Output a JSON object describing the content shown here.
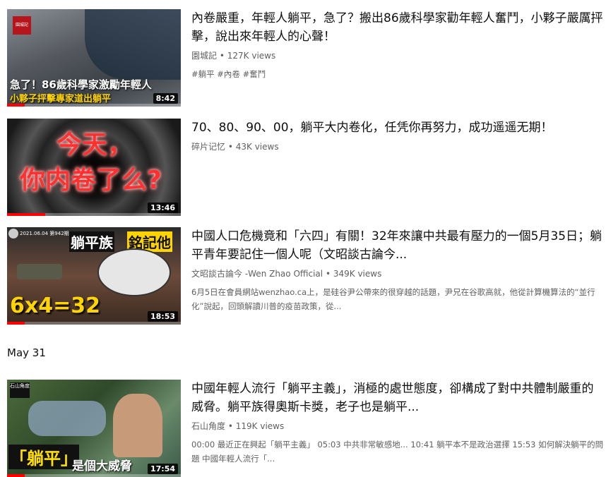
{
  "videos": [
    {
      "title": "內卷嚴重，年輕人躺平，急了？搬出86歲科學家勸年輕人奮鬥，小夥子嚴厲抨擊，說出來年輕人的心聲！",
      "channel": "園城記",
      "views": "127K views",
      "tags": "#躺平 #內卷 #奮鬥",
      "duration": "8:42",
      "watched_fraction": 0.1,
      "thumb_line1": "急了！86歲科學家激勵年輕人",
      "thumb_line2": "小夥子抨擊專家道出躺平",
      "logo_text": "園城記"
    },
    {
      "title": "70、80、90、00，躺平大内卷化，任凭你再努力，成功遥遥无期！",
      "channel": "碎片记忆",
      "views": "43K views",
      "duration": "13:46",
      "watched_fraction": 0.22,
      "thumb_line1": "今天，",
      "thumb_line2": "你内卷了么?"
    },
    {
      "title": "中國人口危機竟和「六四」有關！32年來讓中共最有壓力的一個5月35日；躺平青年要記住一個人呢（文昭談古論今...",
      "channel": "文昭談古論今 -Wen Zhao Official",
      "views": "349K views",
      "description": "6月5日在會員網站wenzhao.ca上，是硅谷尹公帶來的很穿越的話題，尹兄在谷歌高就，他從計算機算法的“並行化”說起，回頭解讀川普的疫苗政策，從...",
      "duration": "18:53",
      "watched_fraction": 0.1,
      "thumb_badge": "2021.06.04 第942期",
      "thumb_line1": "躺平族",
      "thumb_line1b": "銘記他",
      "thumb_eq": "6x4=32"
    },
    {
      "title": "中國年輕人流行「躺平主義」，消極的處世態度，卻構成了對中共體制嚴重的威脅。躺平族得奧斯卡獎，老子也是躺平...",
      "channel": "石山角度",
      "views": "119K views",
      "description": "00:00 最近正在興起「躺平主義」 05:03 中共非常敏感地... 10:41 躺平本不是政治選擇 15:53 如何解決躺平的問題 中國年輕人流行「...",
      "duration": "17:54",
      "watched_fraction": 0.1,
      "thumb_line1": "「躺平」",
      "thumb_line2": "是個大威脅",
      "logo_text": "石山角度"
    }
  ],
  "date_header": "May 31",
  "colors": {
    "accent": "#ff0000",
    "meta": "#606060"
  }
}
